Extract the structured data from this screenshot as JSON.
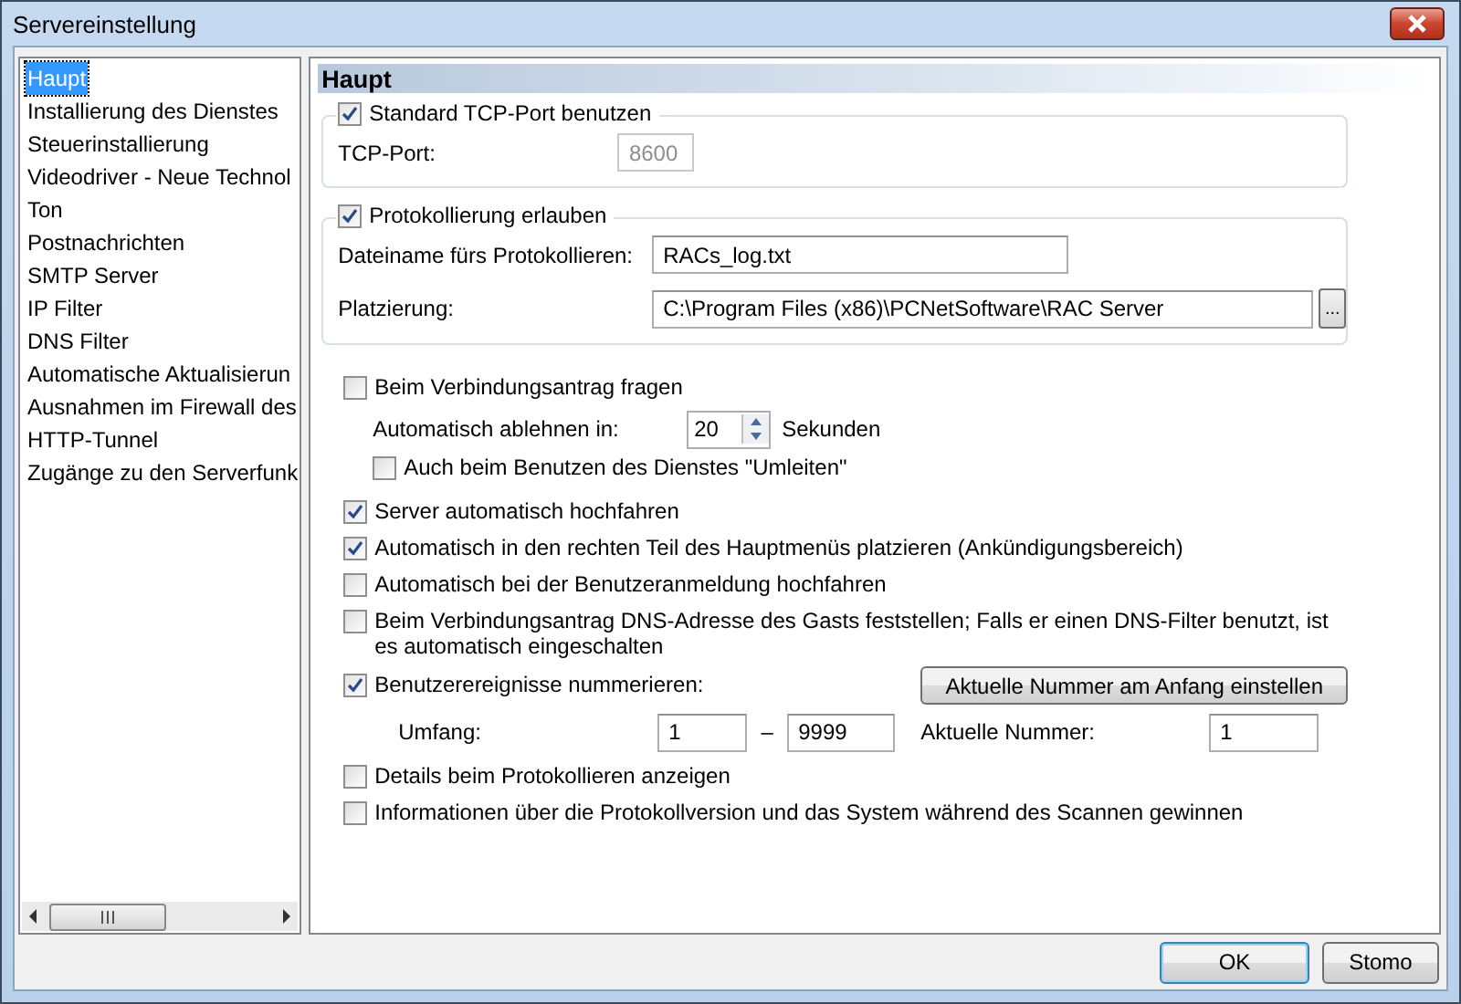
{
  "window": {
    "title": "Servereinstellung"
  },
  "sidebar": {
    "items": [
      {
        "label": "Haupt",
        "selected": true
      },
      {
        "label": "Installierung des Dienstes",
        "selected": false
      },
      {
        "label": "Steuerinstallierung",
        "selected": false
      },
      {
        "label": "Videodriver - Neue Technol",
        "selected": false
      },
      {
        "label": "Ton",
        "selected": false
      },
      {
        "label": "Postnachrichten",
        "selected": false
      },
      {
        "label": "SMTP Server",
        "selected": false
      },
      {
        "label": "IP Filter",
        "selected": false
      },
      {
        "label": "DNS Filter",
        "selected": false
      },
      {
        "label": "Automatische Aktualisierun",
        "selected": false
      },
      {
        "label": "Ausnahmen im Firewall des",
        "selected": false
      },
      {
        "label": "HTTP-Tunnel",
        "selected": false
      },
      {
        "label": "Zugänge zu den Serverfunk",
        "selected": false
      }
    ]
  },
  "panel": {
    "title": "Haupt",
    "tcp_group": {
      "checkbox": {
        "label": "Standard TCP-Port benutzen",
        "checked": true
      },
      "port": {
        "label": "TCP-Port:",
        "value": "8600",
        "disabled": true
      }
    },
    "log_group": {
      "checkbox": {
        "label": "Protokollierung erlauben",
        "checked": true
      },
      "filename": {
        "label": "Dateiname fürs Protokollieren:",
        "value": "RACs_log.txt"
      },
      "location": {
        "label": "Platzierung:",
        "value": "C:\\Program Files (x86)\\PCNetSoftware\\RAC Server",
        "browse": "..."
      }
    },
    "ask": {
      "checkbox": {
        "label": "Beim Verbindungsantrag fragen",
        "checked": false
      },
      "auto_reject": {
        "label": "Automatisch ablehnen in:",
        "value": "20",
        "unit": "Sekunden"
      },
      "redirect": {
        "label": "Auch beim Benutzen des Dienstes \"Umleiten\"",
        "checked": false
      }
    },
    "options": [
      {
        "label": "Server automatisch hochfahren",
        "checked": true
      },
      {
        "label": "Automatisch in den rechten Teil des Hauptmenüs platzieren (Ankündigungsbereich)",
        "checked": true
      },
      {
        "label": "Automatisch bei der Benutzeranmeldung hochfahren",
        "checked": false
      },
      {
        "label": "Beim Verbindungsantrag DNS-Adresse des Gasts feststellen; Falls er einen DNS-Filter benutzt, ist es automatisch eingeschalten",
        "checked": false
      }
    ],
    "numbering": {
      "checkbox": {
        "label": "Benutzerereignisse nummerieren:",
        "checked": true
      },
      "button": "Aktuelle Nummer am Anfang einstellen",
      "range": {
        "label": "Umfang:",
        "from": "1",
        "dash": "–",
        "to": "9999"
      },
      "current": {
        "label": "Aktuelle Nummer:",
        "value": "1"
      }
    },
    "more_options": [
      {
        "label": "Details beim Protokollieren anzeigen",
        "checked": false
      },
      {
        "label": "Informationen über die Protokollversion und das System während des Scannen gewinnen",
        "checked": false
      }
    ]
  },
  "buttons": [
    {
      "label": "OK",
      "default": true
    },
    {
      "label": "Stomo",
      "default": false
    }
  ]
}
